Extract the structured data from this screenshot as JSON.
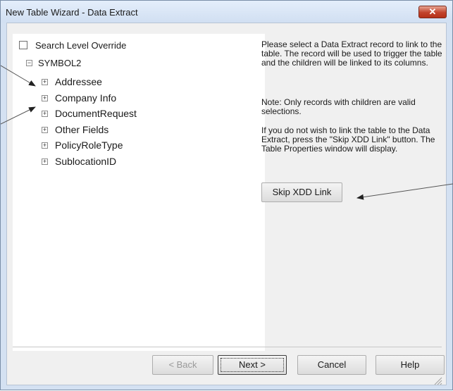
{
  "window": {
    "title": "New Table Wizard - Data Extract",
    "close_glyph": "✕"
  },
  "options": {
    "search_level_override": "Search Level Override",
    "checked": false
  },
  "tree": {
    "root": "SYMBOL2",
    "root_toggle": "−",
    "item_toggle": "+",
    "items": [
      "Addressee",
      "Company Info",
      "DocumentRequest",
      "Other Fields",
      "PolicyRoleType",
      "SublocationID"
    ]
  },
  "info": {
    "paragraph1": "Please select a Data Extract record to link to the table.  The record will be used to trigger the table and the children will be linked to its columns.",
    "paragraph2": "Note: Only records with children are valid selections.",
    "paragraph3": "If you do not wish to link the table to the Data Extract, press the \"Skip XDD Link\" button.  The Table Properties window will display."
  },
  "buttons": {
    "skip": "Skip XDD Link",
    "back": "< Back",
    "next": "Next >",
    "cancel": "Cancel",
    "help": "Help"
  },
  "colors": {
    "title_bar": "#d4e1f2",
    "close_button": "#c2432c",
    "panel": "#ffffff",
    "dialog_bg": "#f0f0f0"
  }
}
